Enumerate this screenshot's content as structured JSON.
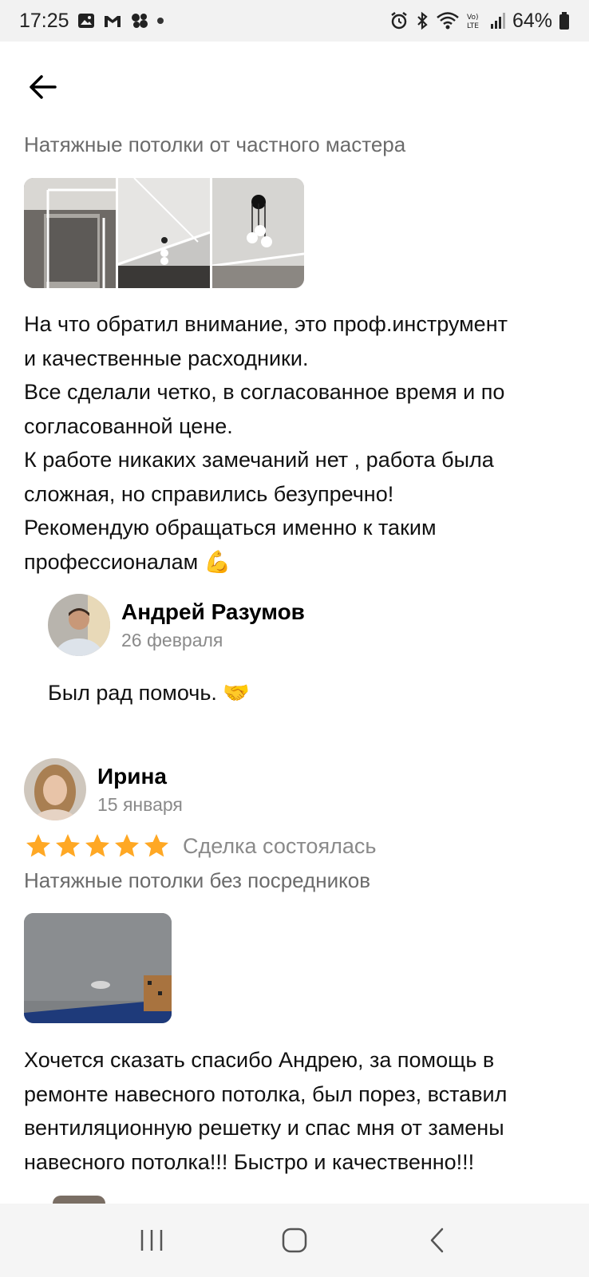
{
  "status_bar": {
    "time": "17:25",
    "battery": "64%",
    "left_icons": [
      "gallery-icon",
      "gmail-icon",
      "app-icon"
    ],
    "right_icons": [
      "alarm-icon",
      "bluetooth-icon",
      "wifi-icon",
      "volte-icon",
      "signal-icon",
      "battery-icon"
    ]
  },
  "header": {
    "back_icon": "arrow-left-icon"
  },
  "review1": {
    "title": "Натяжные потолки от частного мастера",
    "photos": [
      "ceiling-photo-1",
      "ceiling-photo-2",
      "ceiling-photo-3"
    ],
    "text_lines": [
      "На что обратил внимание, это проф.инструмент",
      "и качественные расходники.",
      "Все сделали четко, в согласованное время и по",
      "согласованной цене.",
      "К работе никаких замечаний нет , работа была",
      "сложная, но справились безупречно!",
      "Рекомендую обращаться именно к таким",
      "профессионалам 💪"
    ],
    "reply": {
      "author": "Андрей Разумов",
      "date": "26 февраля",
      "text": "Был рад помочь. 🤝"
    }
  },
  "review2": {
    "author": "Ирина",
    "date": "15 января",
    "rating": 5,
    "deal_status": "Сделка состоялась",
    "title": "Натяжные потолки без посредников",
    "photo": "ceiling-photo-4",
    "text_lines": [
      "Хочется сказать спасибо Андрею, за помощь в",
      "ремонте навесного потолка, был порез, вставил",
      "вентиляционную решетку и спас мня от замены",
      "навесного потолка!!! Быстро и качественно!!!"
    ]
  },
  "nav_bar": {
    "buttons": [
      "recents-icon",
      "home-icon",
      "back-icon"
    ]
  },
  "colors": {
    "star": "#ffa824",
    "muted_text": "#8a8a8a",
    "title_text": "#6b6b6b"
  }
}
